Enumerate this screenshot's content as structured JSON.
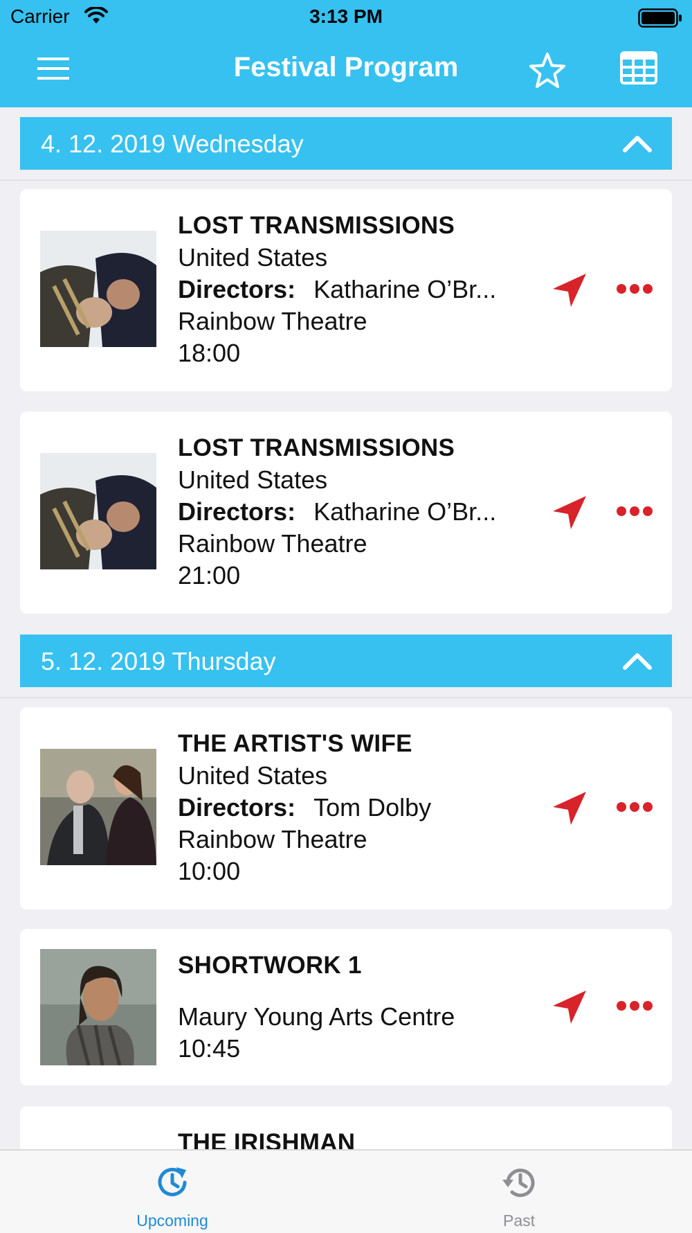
{
  "status_bar": {
    "carrier": "Carrier",
    "time": "3:13 PM"
  },
  "nav": {
    "title": "Festival Program"
  },
  "sections": [
    {
      "date": "4. 12. 2019 Wednesday",
      "events": [
        {
          "title": "LOST TRANSMISSIONS",
          "country": "United States",
          "directors_label": "Directors:",
          "directors": "Katharine O’Br...",
          "venue": "Rainbow Theatre",
          "time": "18:00"
        },
        {
          "title": "LOST TRANSMISSIONS",
          "country": "United States",
          "directors_label": "Directors:",
          "directors": "Katharine O’Br...",
          "venue": "Rainbow Theatre",
          "time": "21:00"
        }
      ]
    },
    {
      "date": "5. 12. 2019 Thursday",
      "events": [
        {
          "title": "THE ARTIST'S WIFE",
          "country": "United States",
          "directors_label": "Directors:",
          "directors": "Tom Dolby",
          "venue": "Rainbow Theatre",
          "time": "10:00"
        },
        {
          "title": "SHORTWORK 1",
          "venue": "Maury Young Arts Centre",
          "time": "10:45"
        },
        {
          "title": "THE IRISHMAN"
        }
      ]
    }
  ],
  "tabs": {
    "upcoming": "Upcoming",
    "past": "Past"
  },
  "colors": {
    "accent": "#36c1f0",
    "action_red": "#d8232a",
    "tab_active": "#1f8ad6",
    "tab_inactive": "#8e8e93"
  },
  "icons": {
    "menu": "hamburger-icon",
    "favorites": "star-icon",
    "schedule": "grid-table-icon",
    "collapse": "chevron-up-icon",
    "navigate": "location-arrow-icon",
    "more": "ellipsis-icon",
    "upcoming": "clock-refresh-icon",
    "past": "history-icon"
  }
}
